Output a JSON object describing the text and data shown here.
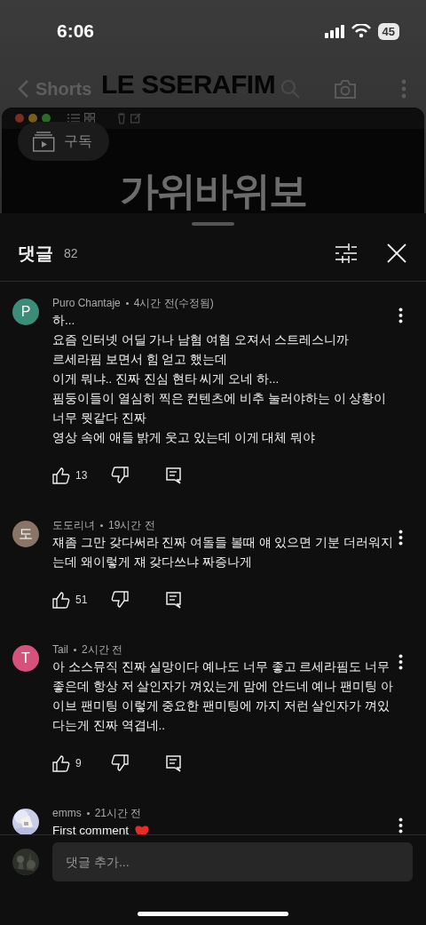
{
  "status_bar": {
    "time": "6:06",
    "battery": "45"
  },
  "header": {
    "title": "Shorts"
  },
  "video": {
    "overlay_title": "LE SSERAFIM",
    "subscribe_label": "구독",
    "heading": "가위바위보"
  },
  "comments_sheet": {
    "title": "댓글",
    "count": "82",
    "comments": [
      {
        "author": "Puro Chantaje",
        "time": "4시간 전(수정됨)",
        "avatar": {
          "kind": "letter",
          "letter": "P",
          "color": "#3b8d7a"
        },
        "body": "하...\n요즘 인터넷 어딜 가나 남혐 여혐 오져서 스트레스니까\n르세라핌 보면서 힘 얻고 했는데\n이게 뭐냐.. 진짜 진심 현타 씨게 오네 하...\n핌둥이들이 열심히 찍은 컨텐츠에 비추 눌러야하는 이 상황이 너무 뭣같다 진짜\n영상 속에 애들 밝게 웃고 있는데 이게 대체 뭐야",
        "likes": "13"
      },
      {
        "author": "도도리녀",
        "time": "19시간 전",
        "avatar": {
          "kind": "letter",
          "letter": "도",
          "color": "#8a7468"
        },
        "body": "쟤좀 그만 갖다써라 진짜 여돌들 볼때 얘 있으면 기분 더러워지는데 왜이렇게 쟤 갖다쓰냐 짜증나게",
        "likes": "51"
      },
      {
        "author": "Tail",
        "time": "2시간 전",
        "avatar": {
          "kind": "letter",
          "letter": "T",
          "color": "#d6527c"
        },
        "body": "아 소스뮤직 진짜 실망이다 예나도 너무 좋고 르세라핌도 너무 좋은데 항상 저 살인자가 껴있는게 맘에 안드네 예나 팬미팅 아이브 팬미팅 이렇게 중요한 팬미팅에 까지 저런 살인자가 껴있다는게 진짜 역겹네..",
        "likes": "9"
      },
      {
        "author": "emms",
        "time": "21시간 전",
        "body": "First comment"
      }
    ],
    "input": {
      "placeholder": "댓글 추가..."
    }
  }
}
